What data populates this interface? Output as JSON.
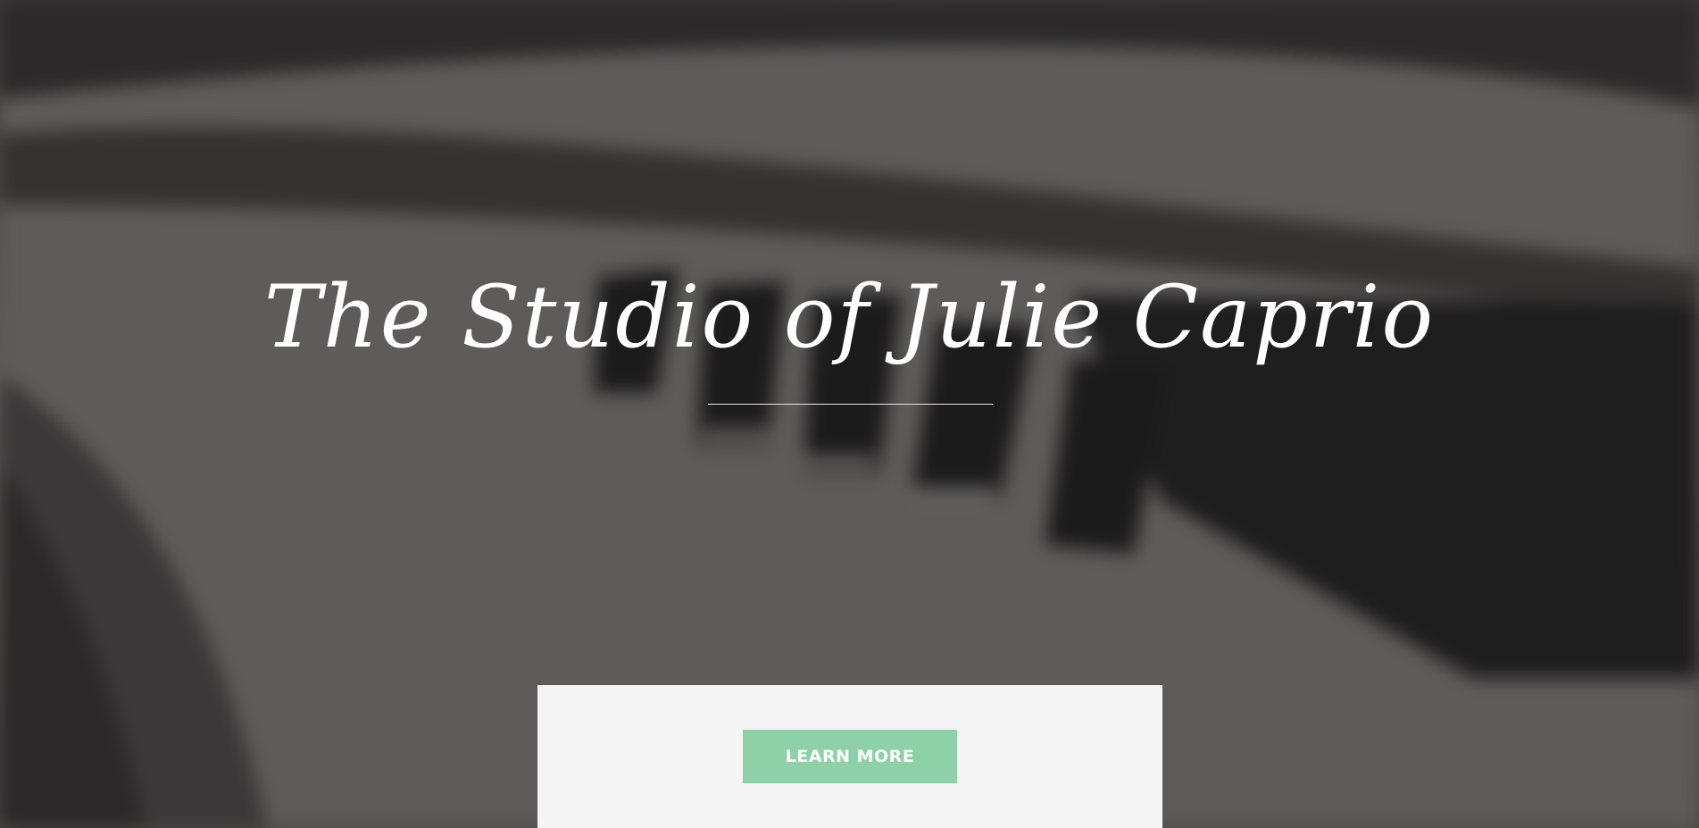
{
  "hero": {
    "title": "The Studio of Julie Caprio",
    "background_image": "piano-keys-closeup"
  },
  "cta": {
    "learn_more_label": "LEARN MORE",
    "button_color": "#8ed1a8"
  }
}
